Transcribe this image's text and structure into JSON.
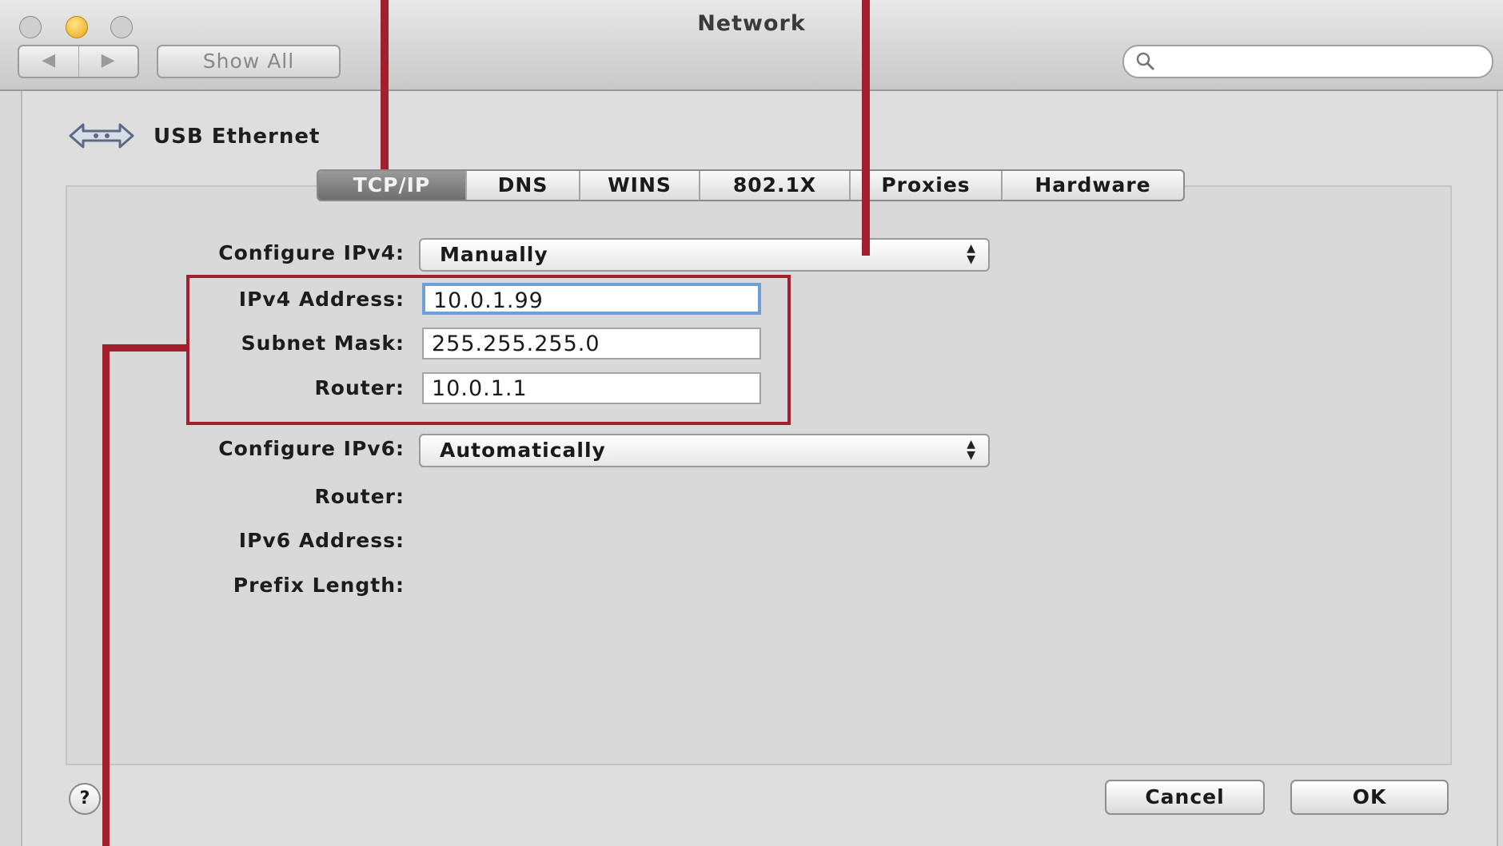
{
  "window": {
    "title": "Network"
  },
  "toolbar": {
    "back_glyph": "◀",
    "forward_glyph": "▶",
    "show_all_label": "Show All",
    "search_icon": "search-icon"
  },
  "interface": {
    "name": "USB Ethernet",
    "icon": "ethernet-arrows-icon"
  },
  "tabs": [
    {
      "label": "TCP/IP",
      "active": true
    },
    {
      "label": "DNS",
      "active": false
    },
    {
      "label": "WINS",
      "active": false
    },
    {
      "label": "802.1X",
      "active": false
    },
    {
      "label": "Proxies",
      "active": false
    },
    {
      "label": "Hardware",
      "active": false
    }
  ],
  "ipv4": {
    "configure_label": "Configure IPv4:",
    "configure_value": "Manually",
    "address_label": "IPv4 Address:",
    "address_value": "10.0.1.99",
    "subnet_label": "Subnet Mask:",
    "subnet_value": "255.255.255.0",
    "router_label": "Router:",
    "router_value": "10.0.1.1"
  },
  "ipv6": {
    "configure_label": "Configure IPv6:",
    "configure_value": "Automatically",
    "router_label": "Router:",
    "address_label": "IPv6 Address:",
    "prefix_label": "Prefix Length:"
  },
  "footer": {
    "help_label": "?",
    "cancel_label": "Cancel",
    "ok_label": "OK"
  },
  "colors": {
    "callout": "#a31f2b",
    "focus_ring": "#6f9fd8",
    "active_tab": "#7a7a7a"
  }
}
